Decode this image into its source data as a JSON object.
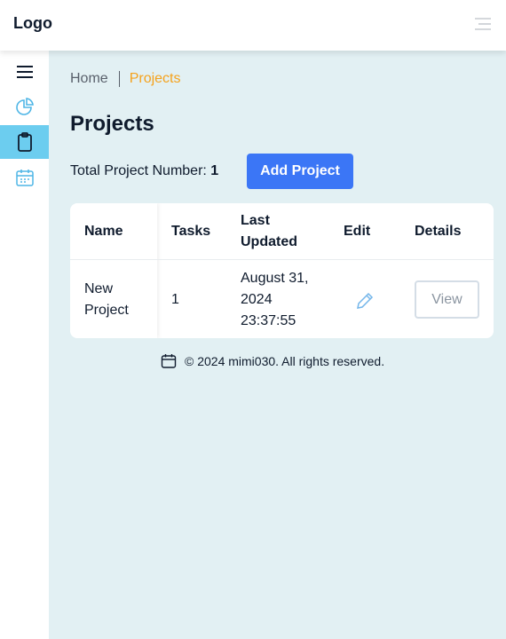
{
  "header": {
    "logo": "Logo",
    "menu_icon": "menu-lines-icon"
  },
  "sidebar": {
    "items": [
      {
        "icon": "hamburger-icon",
        "active": false
      },
      {
        "icon": "pie-chart-icon",
        "active": false
      },
      {
        "icon": "clipboard-icon",
        "active": true
      },
      {
        "icon": "calendar-icon",
        "active": false
      }
    ]
  },
  "breadcrumb": {
    "home": "Home",
    "current": "Projects"
  },
  "page": {
    "title": "Projects",
    "total_label": "Total Project Number:",
    "total_value": "1",
    "add_button": "Add Project"
  },
  "table": {
    "headers": {
      "name": "Name",
      "tasks": "Tasks",
      "last_updated_1": "Last",
      "last_updated_2": "Updated",
      "edit": "Edit",
      "details": "Details"
    },
    "rows": [
      {
        "name_1": "New",
        "name_2": "Project",
        "tasks": "1",
        "updated_1": "August 31,",
        "updated_2": "2024",
        "updated_3": "23:37:55",
        "edit_icon": "pencil-icon",
        "view": "View"
      }
    ]
  },
  "footer": {
    "icon": "calendar-icon",
    "text": "© 2024 mimi030. All rights reserved."
  },
  "colors": {
    "accent": "#3b76f6",
    "breadcrumb_active": "#f5a21c",
    "sidebar_active": "#6ccdef",
    "icon_blue": "#4fb6e6",
    "background": "#e2f0f3"
  }
}
